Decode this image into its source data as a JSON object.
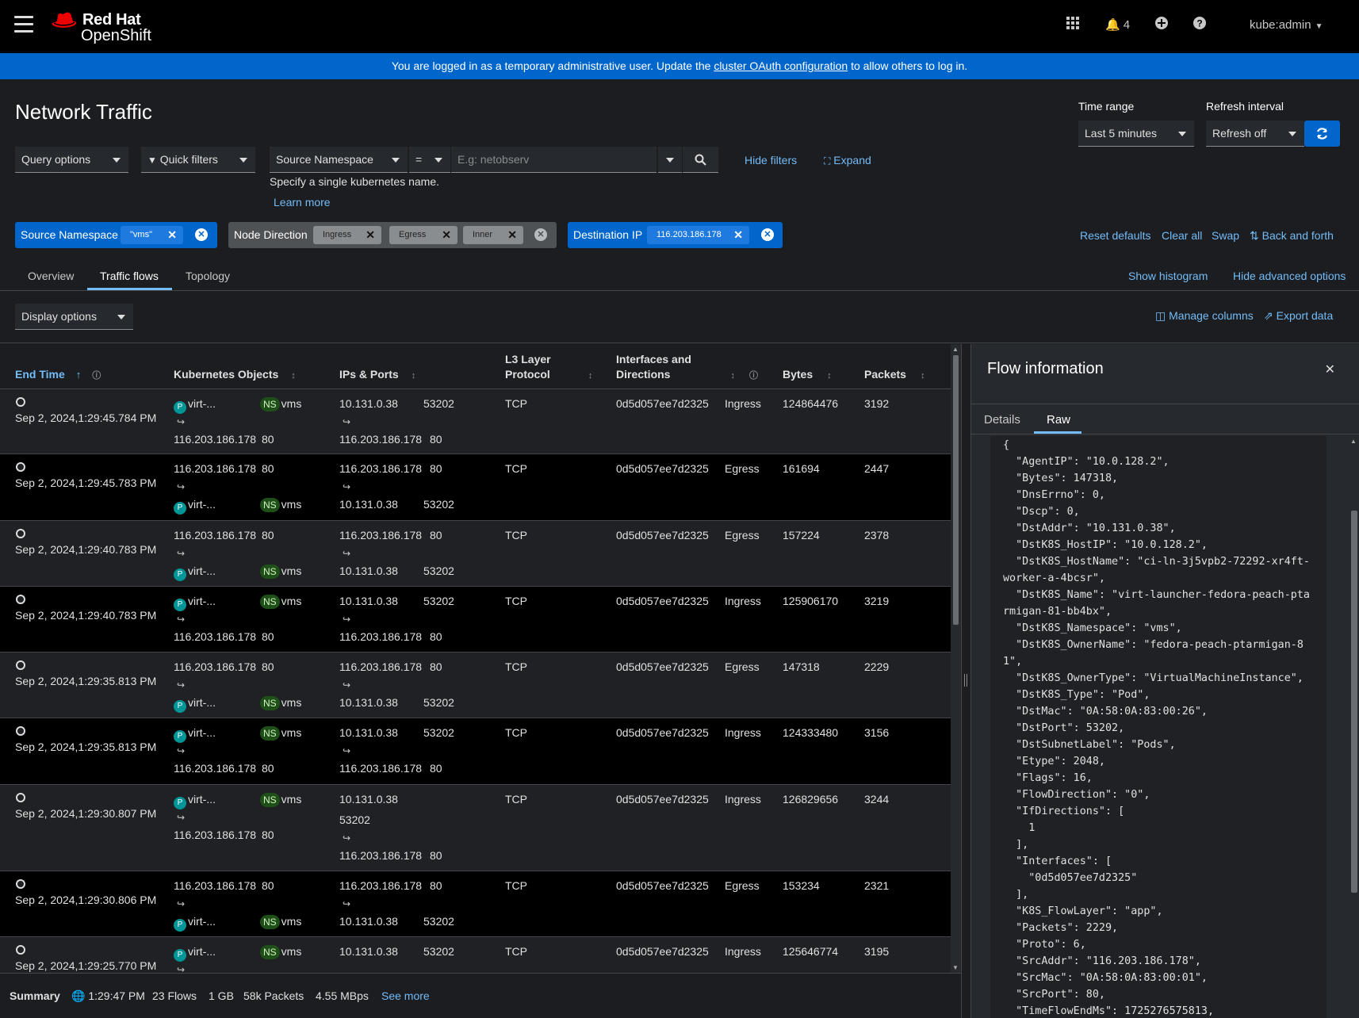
{
  "header": {
    "logo_line1": "Red Hat",
    "logo_line2": "OpenShift",
    "notifications_count": "4",
    "user": "kube:admin"
  },
  "banner": {
    "text_before": "You are logged in as a temporary administrative user. Update the ",
    "link": "cluster OAuth configuration",
    "text_after": " to allow others to log in."
  },
  "page": {
    "title": "Network Traffic",
    "time_range_label": "Time range",
    "time_range_value": "Last 5 minutes",
    "refresh_label": "Refresh interval",
    "refresh_value": "Refresh off"
  },
  "filters": {
    "query_options": "Query options",
    "quick_filters": "Quick filters",
    "field": "Source Namespace",
    "operator": "=",
    "placeholder": "E.g: netobserv",
    "hint": "Specify a single kubernetes name.",
    "learn_more": "Learn more",
    "hide_filters": "Hide filters",
    "expand": "Expand"
  },
  "chips": {
    "group1_name": "Source Namespace",
    "group1_chip1": "\"vms\"",
    "group2_name": "Node Direction",
    "group2_chip1": "Ingress",
    "group2_chip2": "Egress",
    "group2_chip3": "Inner",
    "group3_name": "Destination IP",
    "group3_chip1": "116.203.186.178",
    "reset_defaults": "Reset defaults",
    "clear_all": "Clear all",
    "swap": "Swap",
    "back_and_forth": "Back and forth"
  },
  "tabs": {
    "overview": "Overview",
    "traffic_flows": "Traffic flows",
    "topology": "Topology",
    "show_histogram": "Show histogram",
    "hide_advanced": "Hide advanced options"
  },
  "toolbar": {
    "display_options": "Display options",
    "manage_columns": "Manage columns",
    "export_data": "Export data"
  },
  "columns": {
    "end_time": "End Time",
    "k8s_objects": "Kubernetes Objects",
    "ips_ports": "IPs & Ports",
    "l3_line1": "L3 Layer",
    "l3_line2": "Protocol",
    "if_line1": "Interfaces and",
    "if_line2": "Directions",
    "bytes": "Bytes",
    "packets": "Packets"
  },
  "rows": [
    {
      "date": "Sep 2, 2024,",
      "time": "1:29:45.784 PM",
      "k_top": "virt-...",
      "k_top_ns": "vms",
      "k_bot": "116.203.186.178",
      "k_bot_port": "80",
      "ip_top": "10.131.0.38",
      "ip_top_port": "53202",
      "ip_bot": "116.203.186.178",
      "ip_bot_port": "80",
      "proto": "TCP",
      "iface": "0d5d057ee7d2325",
      "dir": "Ingress",
      "bytes": "124864476",
      "packets": "3192",
      "src_first": "pod"
    },
    {
      "date": "Sep 2, 2024,",
      "time": "1:29:45.783 PM",
      "k_top": "116.203.186.178",
      "k_top_port": "80",
      "k_bot": "virt-...",
      "k_bot_ns": "vms",
      "ip_top": "116.203.186.178",
      "ip_top_port": "80",
      "ip_bot": "10.131.0.38",
      "ip_bot_port": "53202",
      "proto": "TCP",
      "iface": "0d5d057ee7d2325",
      "dir": "Egress",
      "bytes": "161694",
      "packets": "2447",
      "src_first": "ip"
    },
    {
      "date": "Sep 2, 2024,",
      "time": "1:29:40.783 PM",
      "k_top": "116.203.186.178",
      "k_top_port": "80",
      "k_bot": "virt-...",
      "k_bot_ns": "vms",
      "ip_top": "116.203.186.178",
      "ip_top_port": "80",
      "ip_bot": "10.131.0.38",
      "ip_bot_port": "53202",
      "proto": "TCP",
      "iface": "0d5d057ee7d2325",
      "dir": "Egress",
      "bytes": "157224",
      "packets": "2378",
      "src_first": "ip"
    },
    {
      "date": "Sep 2, 2024,",
      "time": "1:29:40.783 PM",
      "k_top": "virt-...",
      "k_top_ns": "vms",
      "k_bot": "116.203.186.178",
      "k_bot_port": "80",
      "ip_top": "10.131.0.38",
      "ip_top_port": "53202",
      "ip_bot": "116.203.186.178",
      "ip_bot_port": "80",
      "proto": "TCP",
      "iface": "0d5d057ee7d2325",
      "dir": "Ingress",
      "bytes": "125906170",
      "packets": "3219",
      "src_first": "pod"
    },
    {
      "date": "Sep 2, 2024,",
      "time": "1:29:35.813 PM",
      "k_top": "116.203.186.178",
      "k_top_port": "80",
      "k_bot": "virt-...",
      "k_bot_ns": "vms",
      "ip_top": "116.203.186.178",
      "ip_top_port": "80",
      "ip_bot": "10.131.0.38",
      "ip_bot_port": "53202",
      "proto": "TCP",
      "iface": "0d5d057ee7d2325",
      "dir": "Egress",
      "bytes": "147318",
      "packets": "2229",
      "src_first": "ip"
    },
    {
      "date": "Sep 2, 2024,",
      "time": "1:29:35.813 PM",
      "k_top": "virt-...",
      "k_top_ns": "vms",
      "k_bot": "116.203.186.178",
      "k_bot_port": "80",
      "ip_top": "10.131.0.38",
      "ip_top_port": "53202",
      "ip_bot": "116.203.186.178",
      "ip_bot_port": "80",
      "proto": "TCP",
      "iface": "0d5d057ee7d2325",
      "dir": "Ingress",
      "bytes": "124333480",
      "packets": "3156",
      "src_first": "pod"
    },
    {
      "date": "Sep 2, 2024,",
      "time": "1:29:30.807 PM",
      "k_top": "virt-...",
      "k_top_ns": "vms",
      "k_bot": "116.203.186.178",
      "k_bot_port": "80",
      "ip_top": "10.131.0.38",
      "ip_top_port": "53202",
      "ip_bot": "116.203.186.178",
      "ip_bot_port": "80",
      "proto": "TCP",
      "iface": "0d5d057ee7d2325",
      "dir": "Ingress",
      "bytes": "126829656",
      "packets": "3244",
      "src_first": "pod"
    },
    {
      "date": "Sep 2, 2024,",
      "time": "1:29:30.806 PM",
      "k_top": "116.203.186.178",
      "k_top_port": "80",
      "k_bot": "virt-...",
      "k_bot_ns": "vms",
      "ip_top": "116.203.186.178",
      "ip_top_port": "80",
      "ip_bot": "10.131.0.38",
      "ip_bot_port": "53202",
      "proto": "TCP",
      "iface": "0d5d057ee7d2325",
      "dir": "Egress",
      "bytes": "153234",
      "packets": "2321",
      "src_first": "ip"
    },
    {
      "date": "Sep 2, 2024,",
      "time": "1:29:25.770 PM",
      "k_top": "virt-...",
      "k_top_ns": "vms",
      "k_bot": "",
      "k_bot_port": "",
      "ip_top": "10.131.0.38",
      "ip_top_port": "53202",
      "ip_bot": "",
      "ip_bot_port": "",
      "proto": "TCP",
      "iface": "0d5d057ee7d2325",
      "dir": "Ingress",
      "bytes": "125646774",
      "packets": "3195",
      "src_first": "pod"
    }
  ],
  "panel": {
    "title": "Flow information",
    "tab_details": "Details",
    "tab_raw": "Raw",
    "raw_json": "{\n  \"AgentIP\": \"10.0.128.2\",\n  \"Bytes\": 147318,\n  \"DnsErrno\": 0,\n  \"Dscp\": 0,\n  \"DstAddr\": \"10.131.0.38\",\n  \"DstK8S_HostIP\": \"10.0.128.2\",\n  \"DstK8S_HostName\": \"ci-ln-3j5vpb2-72292-xr4ft-worker-a-4bcsr\",\n  \"DstK8S_Name\": \"virt-launcher-fedora-peach-ptarmigan-81-bb4bx\",\n  \"DstK8S_Namespace\": \"vms\",\n  \"DstK8S_OwnerName\": \"fedora-peach-ptarmigan-81\",\n  \"DstK8S_OwnerType\": \"VirtualMachineInstance\",\n  \"DstK8S_Type\": \"Pod\",\n  \"DstMac\": \"0A:58:0A:83:00:26\",\n  \"DstPort\": 53202,\n  \"DstSubnetLabel\": \"Pods\",\n  \"Etype\": 2048,\n  \"Flags\": 16,\n  \"FlowDirection\": \"0\",\n  \"IfDirections\": [\n    1\n  ],\n  \"Interfaces\": [\n    \"0d5d057ee7d2325\"\n  ],\n  \"K8S_FlowLayer\": \"app\",\n  \"Packets\": 2229,\n  \"Proto\": 6,\n  \"SrcAddr\": \"116.203.186.178\",\n  \"SrcMac\": \"0A:58:0A:83:00:01\",\n  \"SrcPort\": 80,\n  \"TimeFlowEndMs\": 1725276575813,"
  },
  "summary": {
    "label": "Summary",
    "time": "1:29:47 PM",
    "flows": "23 Flows",
    "size": "1 GB",
    "packets": "58k Packets",
    "rate": "4.55 MBps",
    "see_more": "See more"
  },
  "badges": {
    "pod": "P",
    "ns": "NS",
    "arrow": "↪"
  }
}
